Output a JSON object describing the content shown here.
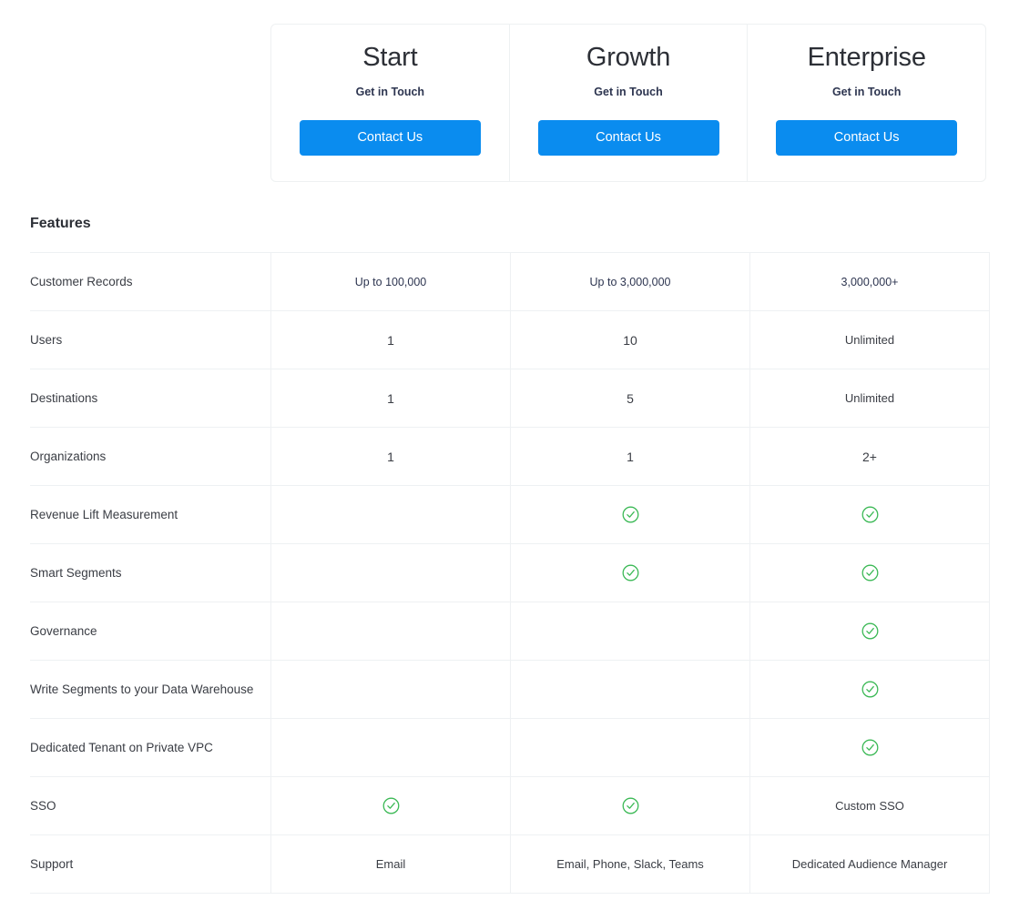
{
  "colors": {
    "cta_blue": "#0a8cef",
    "check_green": "#3cb956",
    "border": "#eef1f3",
    "text": "#3a3d44",
    "heading": "#2c2f36"
  },
  "plans": [
    {
      "name": "Start",
      "subtitle": "Get in Touch",
      "cta_label": "Contact Us"
    },
    {
      "name": "Growth",
      "subtitle": "Get in Touch",
      "cta_label": "Contact Us"
    },
    {
      "name": "Enterprise",
      "subtitle": "Get in Touch",
      "cta_label": "Contact Us"
    }
  ],
  "features_section": {
    "title": "Features"
  },
  "feature_rows": [
    {
      "label": "Customer Records",
      "start": "Up to 100,000",
      "growth": "Up to 3,000,000",
      "enterprise": "3,000,000+",
      "start_check": false,
      "growth_check": false,
      "enterprise_check": false
    },
    {
      "label": "Users",
      "start": "1",
      "growth": "10",
      "enterprise": "Unlimited",
      "start_check": false,
      "growth_check": false,
      "enterprise_check": false
    },
    {
      "label": "Destinations",
      "start": "1",
      "growth": "5",
      "enterprise": "Unlimited",
      "start_check": false,
      "growth_check": false,
      "enterprise_check": false
    },
    {
      "label": "Organizations",
      "start": "1",
      "growth": "1",
      "enterprise": "2+",
      "start_check": false,
      "growth_check": false,
      "enterprise_check": false
    },
    {
      "label": "Revenue Lift Measurement",
      "start": "",
      "growth": "",
      "enterprise": "",
      "start_check": false,
      "growth_check": true,
      "enterprise_check": true
    },
    {
      "label": "Smart Segments",
      "start": "",
      "growth": "",
      "enterprise": "",
      "start_check": false,
      "growth_check": true,
      "enterprise_check": true
    },
    {
      "label": "Governance",
      "start": "",
      "growth": "",
      "enterprise": "",
      "start_check": false,
      "growth_check": false,
      "enterprise_check": true
    },
    {
      "label": "Write Segments to your Data Warehouse",
      "start": "",
      "growth": "",
      "enterprise": "",
      "start_check": false,
      "growth_check": false,
      "enterprise_check": true
    },
    {
      "label": "Dedicated Tenant on Private VPC",
      "start": "",
      "growth": "",
      "enterprise": "",
      "start_check": false,
      "growth_check": false,
      "enterprise_check": true
    },
    {
      "label": "SSO",
      "start": "",
      "growth": "",
      "enterprise": "Custom SSO",
      "start_check": true,
      "growth_check": true,
      "enterprise_check": false
    },
    {
      "label": "Support",
      "start": "Email",
      "growth": "Email, Phone, Slack, Teams",
      "enterprise": "Dedicated Audience Manager",
      "start_check": false,
      "growth_check": false,
      "enterprise_check": false
    }
  ],
  "icons": {
    "check_circle": "check-circle-icon"
  }
}
